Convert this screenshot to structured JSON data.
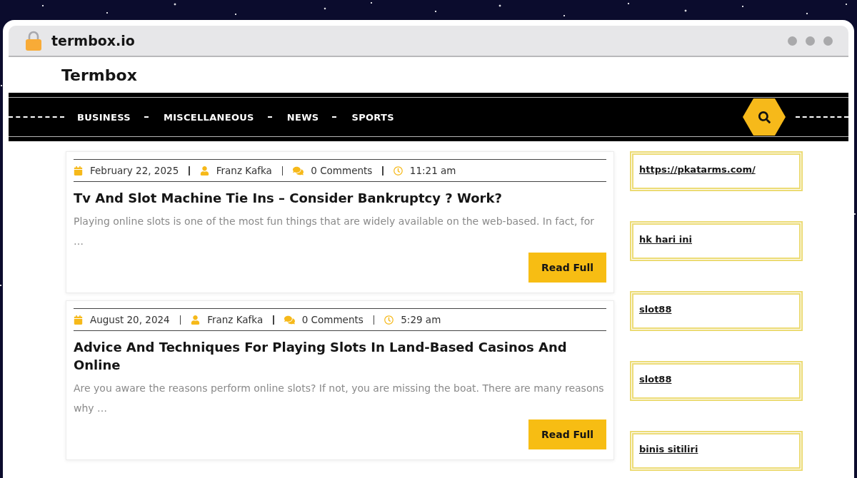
{
  "browser": {
    "url": "termbox.io"
  },
  "site": {
    "title": "Termbox"
  },
  "nav": {
    "items": [
      {
        "label": "BUSINESS"
      },
      {
        "label": "MISCELLANEOUS"
      },
      {
        "label": "NEWS"
      },
      {
        "label": "SPORTS"
      }
    ]
  },
  "posts": [
    {
      "date": "February 22, 2025",
      "author": "Franz Kafka",
      "comments": "0 Comments",
      "time": "11:21 am",
      "title": "Tv And Slot Machine Tie Ins – Consider Bankruptcy ? Work?",
      "excerpt": "Playing online slots is one of the most fun things that are widely available on the web-based. In fact, for …",
      "button": "Read Full"
    },
    {
      "date": "August 20, 2024",
      "author": "Franz Kafka",
      "comments": "0 Comments",
      "time": "5:29 am",
      "title": "Advice And Techniques For Playing Slots In Land-Based Casinos And Online",
      "excerpt": "Are you aware the reasons perform online slots? If not, you are missing the boat. There are many reasons why …",
      "button": "Read Full"
    }
  ],
  "sidebar": {
    "links": [
      {
        "label": "https://pkatarms.com/"
      },
      {
        "label": "hk hari ini"
      },
      {
        "label": "slot88"
      },
      {
        "label": "slot88"
      },
      {
        "label": "binis sitiliri"
      }
    ]
  }
}
